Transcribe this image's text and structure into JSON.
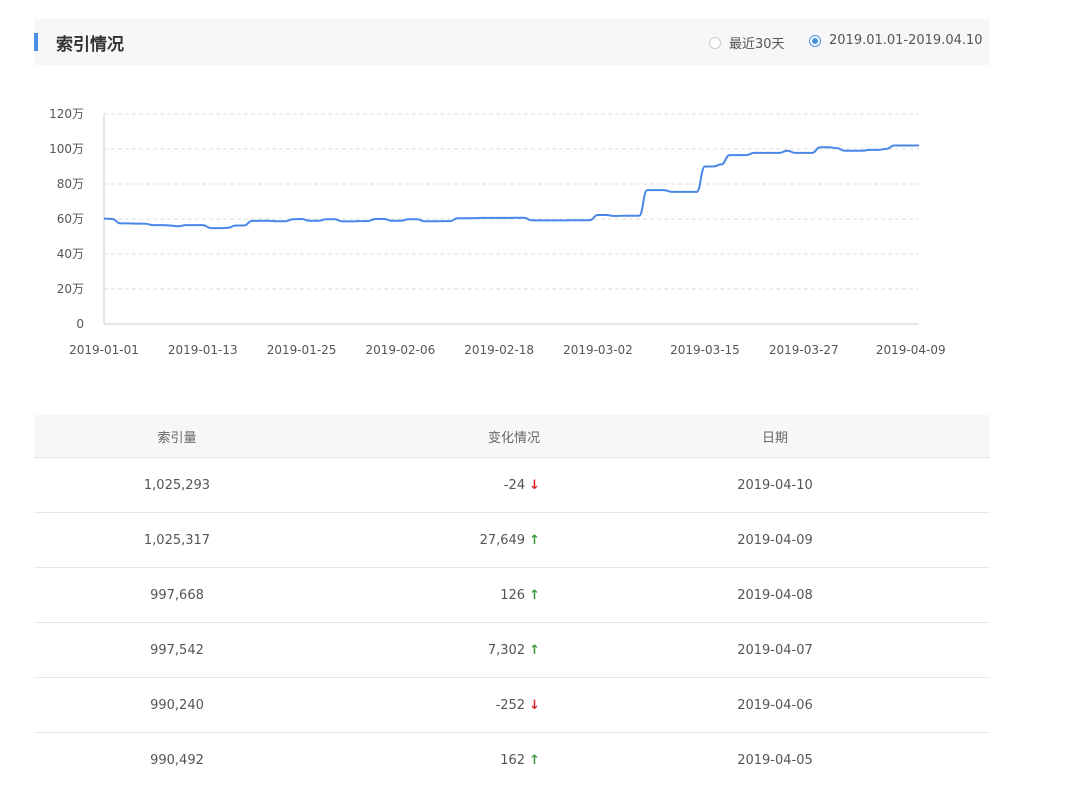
{
  "header": {
    "title": "索引情况",
    "options": [
      {
        "label": "最近30天",
        "checked": false
      },
      {
        "label": "2019.01.01-2019.04.10",
        "checked": true
      }
    ]
  },
  "chart_data": {
    "type": "line",
    "title": "",
    "xlabel": "",
    "ylabel": "",
    "ylim": [
      0,
      1200000
    ],
    "y_ticks": [
      "0",
      "20万",
      "40万",
      "60万",
      "80万",
      "100万",
      "120万"
    ],
    "x_ticks": [
      "2019-01-01",
      "2019-01-13",
      "2019-01-25",
      "2019-02-06",
      "2019-02-18",
      "2019-03-02",
      "2019-03-15",
      "2019-03-27",
      "2019-04-09"
    ],
    "grid": true,
    "line_color": "#4a86e8",
    "series": [
      {
        "x": [
          "2019-01-01",
          "2019-01-02",
          "2019-01-03",
          "2019-01-04",
          "2019-01-05",
          "2019-01-06",
          "2019-01-07",
          "2019-01-08",
          "2019-01-09",
          "2019-01-10",
          "2019-01-11",
          "2019-01-12",
          "2019-01-13",
          "2019-01-14",
          "2019-01-15",
          "2019-01-16",
          "2019-01-17",
          "2019-01-18",
          "2019-01-19",
          "2019-01-20",
          "2019-01-21",
          "2019-01-22",
          "2019-01-23",
          "2019-01-24",
          "2019-01-25",
          "2019-01-26",
          "2019-01-27",
          "2019-01-28",
          "2019-01-29",
          "2019-01-30",
          "2019-01-31",
          "2019-02-01",
          "2019-02-02",
          "2019-02-03",
          "2019-02-04",
          "2019-02-05",
          "2019-02-06",
          "2019-02-07",
          "2019-02-08",
          "2019-02-09",
          "2019-02-10",
          "2019-02-11",
          "2019-02-12",
          "2019-02-13",
          "2019-02-14",
          "2019-02-15",
          "2019-02-16",
          "2019-02-17",
          "2019-02-18",
          "2019-02-19",
          "2019-02-20",
          "2019-02-21",
          "2019-02-22",
          "2019-02-23",
          "2019-02-24",
          "2019-02-25",
          "2019-02-26",
          "2019-02-27",
          "2019-02-28",
          "2019-03-01",
          "2019-03-02",
          "2019-03-03",
          "2019-03-04",
          "2019-03-05",
          "2019-03-06",
          "2019-03-07",
          "2019-03-08",
          "2019-03-09",
          "2019-03-10",
          "2019-03-11",
          "2019-03-12",
          "2019-03-13",
          "2019-03-14",
          "2019-03-15",
          "2019-03-16",
          "2019-03-17",
          "2019-03-18",
          "2019-03-19",
          "2019-03-20",
          "2019-03-21",
          "2019-03-22",
          "2019-03-23",
          "2019-03-24",
          "2019-03-25",
          "2019-03-26",
          "2019-03-27",
          "2019-03-28",
          "2019-03-29",
          "2019-03-30",
          "2019-03-31",
          "2019-04-01",
          "2019-04-02",
          "2019-04-03",
          "2019-04-04",
          "2019-04-05",
          "2019-04-06",
          "2019-04-07",
          "2019-04-08",
          "2019-04-09",
          "2019-04-10"
        ],
        "y": [
          602000,
          600000,
          575000,
          575000,
          574000,
          573000,
          565000,
          565000,
          563000,
          558000,
          565000,
          565000,
          565000,
          548000,
          548000,
          549000,
          563000,
          563000,
          589000,
          590000,
          590000,
          587000,
          587000,
          599000,
          600000,
          590000,
          590000,
          598000,
          598000,
          586000,
          586000,
          588000,
          588000,
          600000,
          600000,
          590000,
          590000,
          598000,
          598000,
          587000,
          587000,
          588000,
          588000,
          604000,
          604000,
          605000,
          606000,
          606000,
          606000,
          606000,
          607000,
          607000,
          592000,
          592000,
          592000,
          592000,
          592000,
          593000,
          593000,
          593000,
          623000,
          623000,
          617000,
          618000,
          618000,
          618000,
          765000,
          765000,
          765000,
          755000,
          755000,
          755000,
          755000,
          900000,
          900000,
          912000,
          965000,
          965000,
          965000,
          978000,
          978000,
          978000,
          978000,
          990000,
          978000,
          978000,
          978000,
          1010000,
          1010000,
          1005000,
          990000,
          990000,
          990000,
          995000,
          995000,
          1000000,
          1020000,
          1020000,
          1020000,
          1020000
        ]
      }
    ]
  },
  "table": {
    "headers": [
      "索引量",
      "变化情况",
      "日期"
    ],
    "rows": [
      {
        "count": "1,025,293",
        "change": "-24",
        "direction": "down",
        "date": "2019-04-10"
      },
      {
        "count": "1,025,317",
        "change": "27,649",
        "direction": "up",
        "date": "2019-04-09"
      },
      {
        "count": "997,668",
        "change": "126",
        "direction": "up",
        "date": "2019-04-08"
      },
      {
        "count": "997,542",
        "change": "7,302",
        "direction": "up",
        "date": "2019-04-07"
      },
      {
        "count": "990,240",
        "change": "-252",
        "direction": "down",
        "date": "2019-04-06"
      },
      {
        "count": "990,492",
        "change": "162",
        "direction": "up",
        "date": "2019-04-05"
      }
    ]
  }
}
